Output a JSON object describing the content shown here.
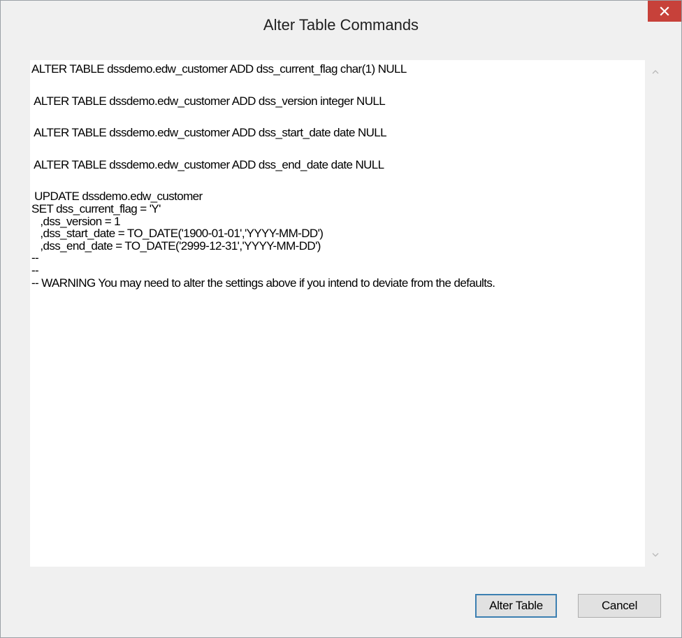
{
  "window": {
    "title": "Alter Table Commands",
    "close_icon": "close-icon"
  },
  "editor": {
    "lines": [
      "ALTER TABLE dssdemo.edw_customer ADD dss_current_flag char(1) NULL",
      "",
      " ALTER TABLE dssdemo.edw_customer ADD dss_version integer NULL",
      "",
      " ALTER TABLE dssdemo.edw_customer ADD dss_start_date date NULL",
      "",
      " ALTER TABLE dssdemo.edw_customer ADD dss_end_date date NULL",
      "",
      " UPDATE dssdemo.edw_customer",
      "SET dss_current_flag = 'Y'",
      "   ,dss_version = 1",
      "   ,dss_start_date = TO_DATE('1900-01-01','YYYY-MM-DD')",
      "   ,dss_end_date = TO_DATE('2999-12-31','YYYY-MM-DD')",
      "--",
      "--",
      "-- WARNING You may need to alter the settings above if you intend to deviate from the defaults."
    ]
  },
  "buttons": {
    "alter_label": "Alter Table",
    "cancel_label": "Cancel"
  },
  "colors": {
    "close_button": "#c7413a",
    "default_button_border": "#3c7fb1",
    "window_bg": "#f0f0f0"
  }
}
